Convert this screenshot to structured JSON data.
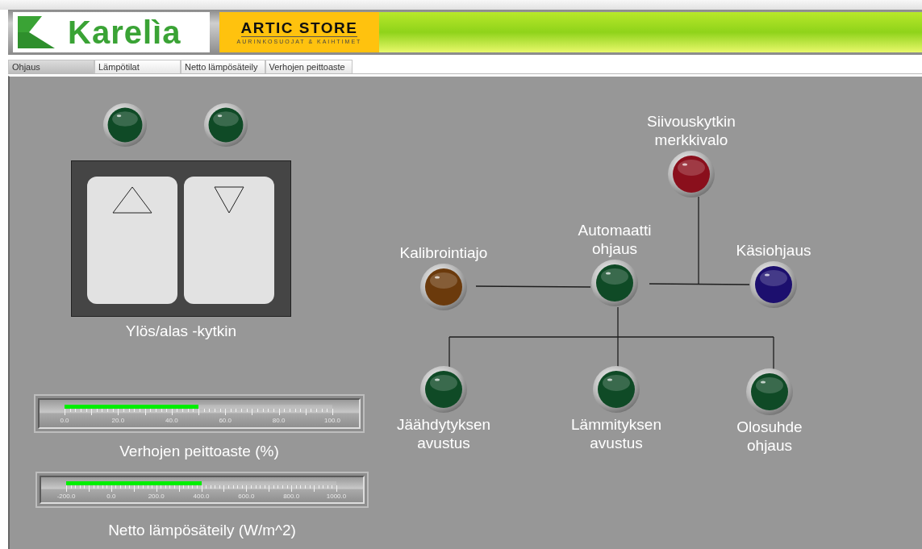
{
  "header": {
    "logo_text": "Karelìa",
    "store_name": "ARTIC STORE",
    "store_tagline": "AURINKOSUOJAT & KAIHTIMET"
  },
  "tabs": [
    {
      "label": "Ohjaus",
      "selected": true
    },
    {
      "label": "Lämpötilat",
      "selected": false
    },
    {
      "label": "Netto lämpösäteily",
      "selected": false
    },
    {
      "label": "Verhojen peittoaste",
      "selected": false
    }
  ],
  "switch_indicators": [
    {
      "color": "#0f4a26"
    },
    {
      "color": "#0f4a26"
    }
  ],
  "switch": {
    "label": "Ylös/alas -kytkin"
  },
  "gauges": [
    {
      "label": "Verhojen peittoaste (%)",
      "level": 0.5,
      "ticks": [
        "0.0",
        "20.0",
        "40.0",
        "60.0",
        "80.0",
        "100.0"
      ]
    },
    {
      "label": "Netto lämpösäteily (W/m^2)",
      "level": 0.5,
      "ticks": [
        "-200.0",
        "0.0",
        "200.0",
        "400.0",
        "600.0",
        "800.0",
        "1000.0"
      ]
    }
  ],
  "diagram": {
    "lamps": [
      {
        "label": "Siivouskytkin merkkivalo",
        "color": "#8a0f1c"
      },
      {
        "label": "Kalibrointiajo",
        "color": "#6b3a0c"
      },
      {
        "label": "Automaatti ohjaus",
        "color": "#0f4a26"
      },
      {
        "label": "Käsiohjaus",
        "color": "#1c0f6e"
      },
      {
        "label": "Jäähdytyksen avustus",
        "color": "#0f4a26"
      },
      {
        "label": "Lämmityksen avustus",
        "color": "#0f4a26"
      },
      {
        "label": "Olosuhde ohjaus",
        "color": "#0f4a26"
      }
    ]
  }
}
